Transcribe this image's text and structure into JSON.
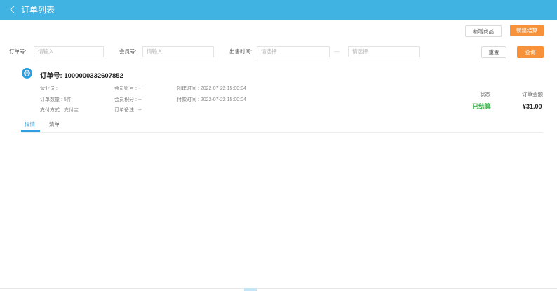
{
  "header": {
    "title": "订单列表",
    "back_icon": "chevron-left-icon"
  },
  "toolbar": {
    "add_product_label": "新增商品",
    "new_checkout_label": "新建结算"
  },
  "filters": {
    "order_no": {
      "label": "订单号:",
      "placeholder": "请输入",
      "value": ""
    },
    "member_no": {
      "label": "会员号:",
      "placeholder": "请输入",
      "value": ""
    },
    "sale_time": {
      "label": "出售时间:",
      "start_placeholder": "请选择",
      "end_placeholder": "请选择",
      "separator": "—"
    },
    "reset_label": "重置",
    "query_label": "查询"
  },
  "order": {
    "icon": "printer-icon",
    "number_label": "订单号:",
    "number": "1000000332607852",
    "col1": [
      {
        "label": "营业员 :",
        "value": ""
      },
      {
        "label": "订单数量 :",
        "value": "5件"
      },
      {
        "label": "支付方式 :",
        "value": "支付宝"
      }
    ],
    "col2": [
      {
        "label": "会员账号 :",
        "value": "--"
      },
      {
        "label": "会员积分 :",
        "value": "--"
      },
      {
        "label": "订单备注 :",
        "value": "--"
      }
    ],
    "col3": [
      {
        "label": "创建时间 :",
        "value": "2022-07-22 15:00:04"
      },
      {
        "label": "付款时间 :",
        "value": "2022-07-22 15:00:04"
      }
    ],
    "status_label": "状态",
    "status_value": "已结算",
    "amount_label": "订单金额",
    "amount_value": "¥31.00",
    "tabs": [
      {
        "label": "详情",
        "active": true
      },
      {
        "label": "清单",
        "active": false
      }
    ]
  },
  "colors": {
    "header": "#41b3e3",
    "accent_orange": "#f7923a",
    "status_green": "#3bb54a",
    "tab_active": "#2f9fe0",
    "icon_blue": "#2b9ee3"
  }
}
